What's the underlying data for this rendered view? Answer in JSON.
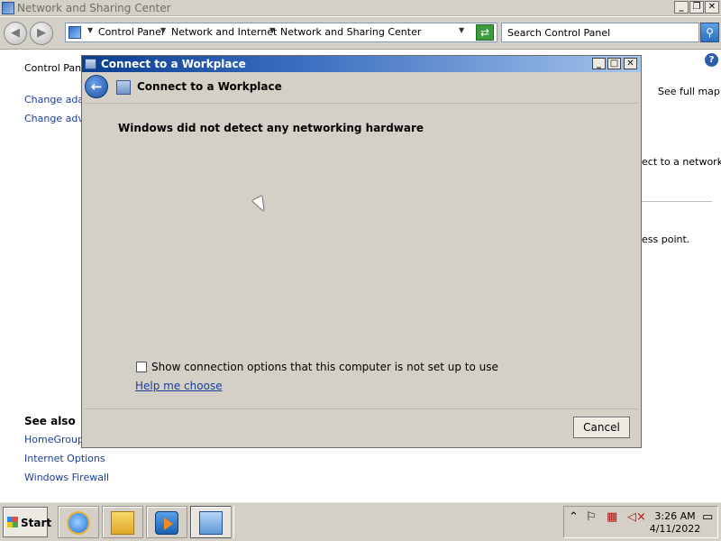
{
  "window": {
    "title": "Network and Sharing Center"
  },
  "address_bar": {
    "crumbs": [
      "Control Panel",
      "Network and Internet",
      "Network and Sharing Center"
    ]
  },
  "search": {
    "placeholder": "Search Control Panel"
  },
  "left_pane": {
    "home": "Control Pane",
    "link1": "Change adap",
    "link2": "Change adva",
    "see_also": "See also",
    "see_also_items": [
      "HomeGroup",
      "Internet Options",
      "Windows Firewall"
    ]
  },
  "right_pane": {
    "see_full_map": "See full map",
    "connect_fragment": "ect to a network",
    "access_point_fragment": "ess point."
  },
  "dialog": {
    "title": "Connect to a Workplace",
    "header": "Connect to a Workplace",
    "message": "Windows did not detect any networking hardware",
    "checkbox_label": "Show connection options that this computer is not set up to use",
    "checkbox_checked": false,
    "help_link": "Help me choose",
    "cancel": "Cancel"
  },
  "taskbar": {
    "start": "Start",
    "time": "3:26 AM",
    "date": "4/11/2022"
  },
  "icons": {
    "back": "back-arrow-icon",
    "forward": "forward-arrow-icon",
    "help": "help-icon"
  },
  "colors": {
    "dialog_title_bar": "#0b3d91",
    "link": "#1a3e9c",
    "chrome": "#d4d0c8"
  }
}
